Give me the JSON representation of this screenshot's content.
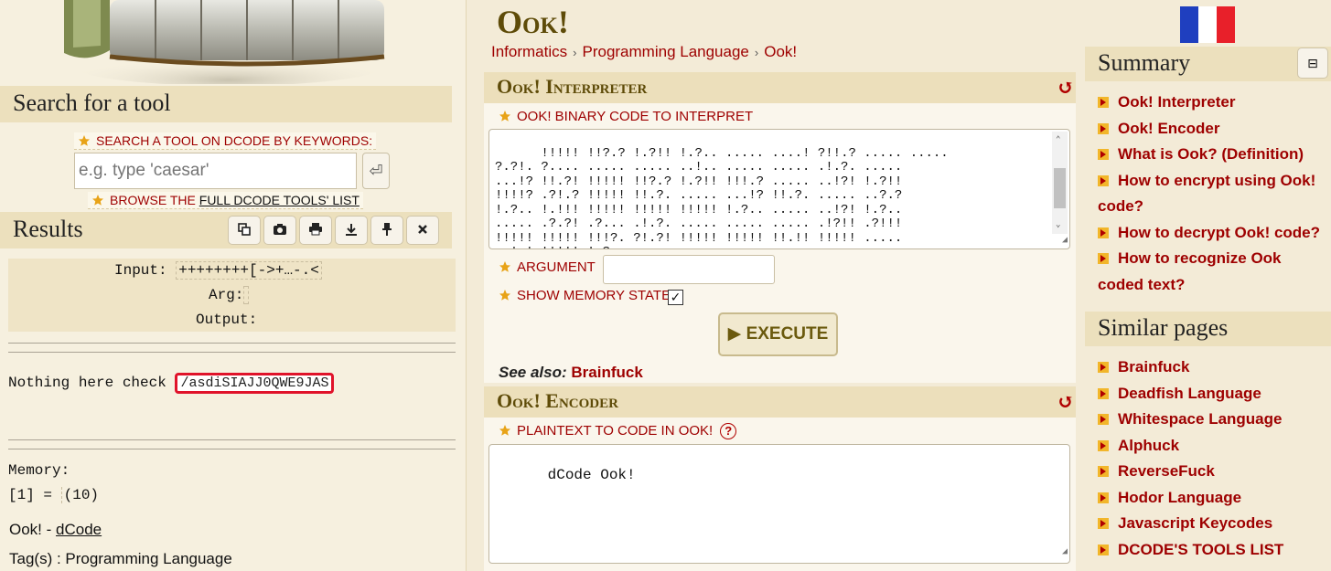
{
  "left": {
    "search_heading": "Search for a tool",
    "search_label": "Search a tool on dCode by keywords:",
    "search_placeholder": "e.g. type 'caesar'",
    "search_go": "⏎",
    "browse_prefix": "Browse the ",
    "browse_link": "full dCode tools' list",
    "results_heading": "Results",
    "result_tools": [
      "copy-icon",
      "camera-icon",
      "print-icon",
      "download-icon",
      "pin-icon",
      "close-icon"
    ],
    "results": {
      "input_label": "Input:",
      "input_value": "++++++++[->+…-.<",
      "arg_label": "Arg:",
      "arg_value": "",
      "output_label": "Output:"
    },
    "message_prefix": "Nothing here check ",
    "message_highlight": "/asdiSIAJJ0QWE9JAS",
    "memory_label": "Memory:",
    "memory_line_prefix": "[1] = ",
    "memory_value": "(10)",
    "credit_prefix": "Ook! - ",
    "credit_link": "dCode",
    "tags": "Tag(s) : Programming Language"
  },
  "main": {
    "title": "Ook!",
    "breadcrumb": [
      "Informatics",
      "Programming Language",
      "Ook!"
    ],
    "interpreter": {
      "heading": "Ook! Interpreter",
      "code_label": "Ook! binary code to interpret",
      "code_value": "!!!!! !!?.? !.?!! !.?.. ..... ....! ?!!.? ..... .....\n?.?!. ?.... ..... ..... ..!.. ..... ..... .!.?. .....\n...!? !!.?! !!!!! !!?.? !.?!! !!!.? ..... ..!?! !.?!!\n!!!!? .?!.? !!!!! !!.?. ..... ...!? !!.?. ..... ..?.?\n!.?.. !.!!! !!!!! !!!!! !!!!! !.?.. ..... ..!?! !.?..\n..... .?.?! .?... .!.?. ..... ..... ..... .!?!! .?!!!\n!!!!! !!!!! !!!?. ?!.?! !!!!! !!!!! !!.!! !!!!! .....\n..!.! !!!!! !.?.",
      "argument_label": "Argument",
      "memory_label": "Show memory state",
      "memory_checked": "✓",
      "execute_label": "▶ EXECUTE",
      "see_also_label": "See also:",
      "see_also_link": "Brainfuck"
    },
    "encoder": {
      "heading": "Ook! Encoder",
      "plaintext_label": "Plaintext to code in Ook!",
      "help": "?",
      "plaintext_value": "dCode Ook!"
    }
  },
  "sidebar": {
    "summary_heading": "Summary",
    "collapse": "⊟",
    "summary_items": [
      "Ook! Interpreter",
      "Ook! Encoder",
      "What is Ook? (Definition)",
      "How to encrypt using Ook! code?",
      "How to decrypt Ook! code?",
      "How to recognize Ook coded text?"
    ],
    "similar_heading": "Similar pages",
    "similar_items": [
      "Brainfuck",
      "Deadfish Language",
      "Whitespace Language",
      "Alphuck",
      "ReverseFuck",
      "Hodor Language",
      "Javascript Keycodes",
      "DCODE'S TOOLS LIST"
    ]
  },
  "colors": {
    "link": "#9e0000",
    "title": "#5e4b08",
    "panel_head": "#ecdfbb",
    "highlight_border": "#e0132a"
  }
}
